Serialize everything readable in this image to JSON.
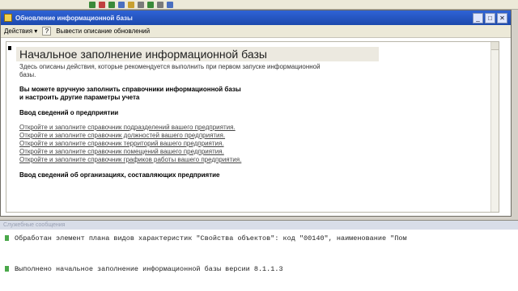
{
  "window": {
    "title": "Обновление информационной базы",
    "min_label": "_",
    "max_label": "□",
    "close_label": "✕"
  },
  "cmdbar": {
    "actions_label": "Действия ▾",
    "help_label": "?",
    "describe_label": "Вывести описание обновлений"
  },
  "content": {
    "heading": "Начальное заполнение информационной базы",
    "description": "Здесь описаны действия, которые рекомендуется выполнить при первом запуске информационной базы.",
    "manual_fill_line1": "Вы можете вручную заполнить справочники информационной базы",
    "manual_fill_line2": "и настроить другие параметры учета",
    "enterprise_section": "Ввод сведений о предприятии",
    "links": [
      "Откройте и заполните справочник подразделений вашего предприятия.",
      "Откройте и заполните справочник должностей вашего предприятия.",
      "Откройте и заполните справочник территорий вашего предприятия.",
      "Откройте и заполните справочник помещений вашего предприятия.",
      "Откройте и заполните справочник графиков работы вашего предприятия."
    ],
    "orgs_section": "Ввод сведений об организациях, составляющих предприятие"
  },
  "messages": {
    "title": "Служебные сообщения",
    "lines": [
      "Обработан элемент плана видов характеристик \"Свойства объектов\": код \"00140\", наименование \"Пом",
      "Выполнено начальное заполнение информационной базы версии 8.1.1.3"
    ]
  },
  "colors": {
    "titlebar": "#2f63d6",
    "panel": "#ece9d8"
  }
}
